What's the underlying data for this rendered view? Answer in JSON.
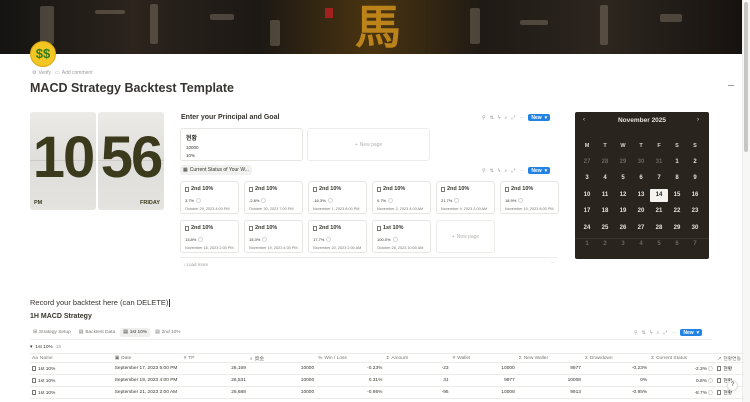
{
  "page": {
    "title": "MACD Strategy Backtest Template",
    "icon": "money-face-icon",
    "verify": "Verify",
    "add_comment": "Add comment"
  },
  "clock": {
    "hour": "10",
    "minute": "56",
    "ampm": "PM",
    "day": "FRIDAY"
  },
  "principal": {
    "heading": "Enter your Principal and Goal",
    "card_title": "현황",
    "card_rows": [
      "10000",
      "10%"
    ],
    "new_page": "New page",
    "new_label": "New"
  },
  "status": {
    "chip_label": "Current Status of Your W...",
    "new_label": "New",
    "new_page": "New page",
    "load_more": "Load more",
    "cards": [
      {
        "title": "2nd 10%",
        "pct": "3.7%",
        "date": "October 29, 2023 4:00 PM"
      },
      {
        "title": "2nd 10%",
        "pct": "-2.8%",
        "date": "October 30, 2023 7:00 PM"
      },
      {
        "title": "2nd 10%",
        "pct": "-16.3%",
        "date": "November 1, 2023 8:00 PM"
      },
      {
        "title": "2nd 10%",
        "pct": "0.7%",
        "date": "November 2, 2023 4:00 AM"
      },
      {
        "title": "2nd 10%",
        "pct": "21.7%",
        "date": "November 9, 2023 2:00 AM"
      },
      {
        "title": "2nd 10%",
        "pct": "18.9%",
        "date": "November 10, 2023 8:00 PM"
      },
      {
        "title": "2nd 10%",
        "pct": "13.8%",
        "date": "November 16, 2023 2:00 PM"
      },
      {
        "title": "2nd 10%",
        "pct": "15.3%",
        "date": "November 19, 2023 4:00 PM"
      },
      {
        "title": "2nd 10%",
        "pct": "17.7%",
        "date": "November 20, 2023 2:00 AM"
      },
      {
        "title": "1st 10%",
        "pct": "100.0%",
        "date": "October 28, 2023 10:00 AM"
      }
    ]
  },
  "calendar": {
    "month": "November 2025",
    "prev": "‹",
    "next": "›",
    "weekdays": [
      "M",
      "T",
      "W",
      "T",
      "F",
      "S",
      "S"
    ],
    "today": "14",
    "weeks": [
      [
        "27",
        "28",
        "29",
        "30",
        "31",
        "1",
        "2"
      ],
      [
        "3",
        "4",
        "5",
        "6",
        "7",
        "8",
        "9"
      ],
      [
        "10",
        "11",
        "12",
        "13",
        "14",
        "15",
        "16"
      ],
      [
        "17",
        "18",
        "19",
        "20",
        "21",
        "22",
        "23"
      ],
      [
        "24",
        "25",
        "26",
        "27",
        "28",
        "29",
        "30"
      ],
      [
        "1",
        "2",
        "3",
        "4",
        "5",
        "6",
        "7"
      ]
    ]
  },
  "backtest": {
    "heading": "Record your backtest here (can DELETE)",
    "sub_heading": "1H MACD Strategy",
    "tabs": [
      {
        "label": "Strategy Setup",
        "active": false
      },
      {
        "label": "Backtest Data",
        "active": false
      },
      {
        "label": "1st 10%",
        "active": true
      },
      {
        "label": "2nd 10%",
        "active": false
      }
    ],
    "new_label": "New",
    "group": {
      "label": "1st 10%",
      "count": "15"
    },
    "columns": [
      "Name",
      "Date",
      "TP",
      "資金",
      "Win / Loss",
      "Amount",
      "Wallet",
      "New Wallet",
      "Drawdown",
      "Current Status",
      "현황연동"
    ],
    "rows": [
      [
        "1st 10%",
        "September 17, 2023 5:00 PM",
        "26,169",
        "10000",
        "-0.23%",
        "-23",
        "10000",
        "9977",
        "-0.23%",
        "-2.3%",
        "현황"
      ],
      [
        "1st 10%",
        "September 19, 2023 4:00 PM",
        "26,531",
        "10000",
        "0.31%",
        "31",
        "9977",
        "10008",
        "0%",
        "0.8%",
        "현황"
      ],
      [
        "1st 10%",
        "September 21, 2023 2:00 AM",
        "26,688",
        "10000",
        "-0.95%",
        "-95",
        "10008",
        "9913",
        "-0.95%",
        "-8.7%",
        "현황"
      ]
    ]
  },
  "colors": {
    "accent": "#2383e2",
    "calendar_bg": "#2a241f",
    "banner_gold": "#c58a1b"
  }
}
